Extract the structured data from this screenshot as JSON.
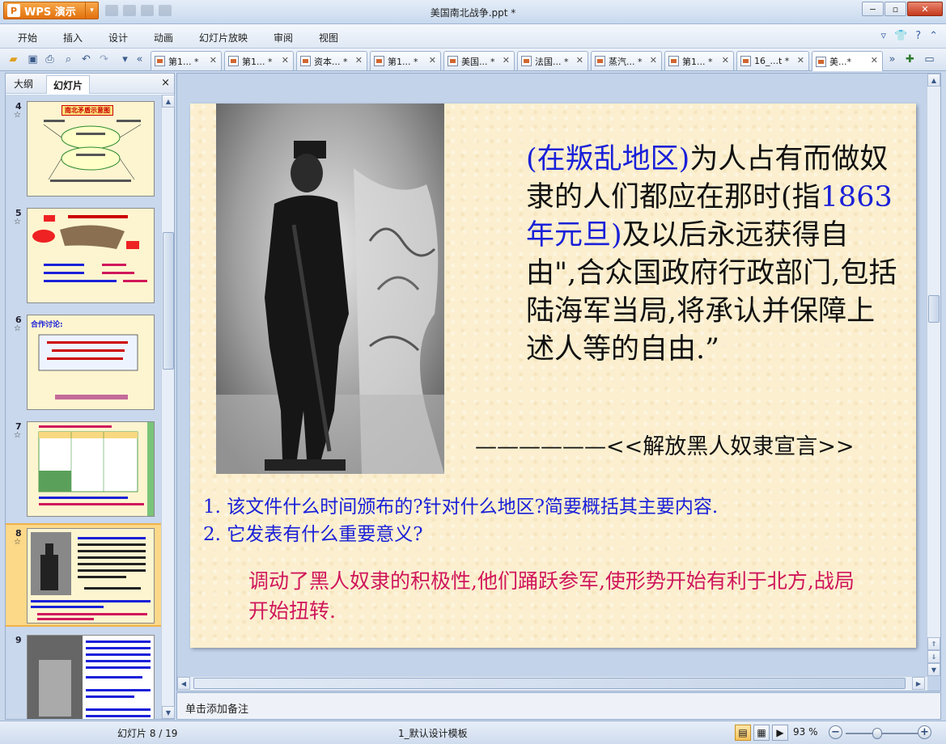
{
  "window": {
    "app_button": "WPS 演示",
    "doc_title": "美国南北战争.ppt *",
    "minimize": "−",
    "restore": "▫",
    "close": "✕"
  },
  "menu": {
    "items": [
      "开始",
      "插入",
      "设计",
      "动画",
      "幻灯片放映",
      "审阅",
      "视图"
    ],
    "help": "?"
  },
  "tabs": [
    {
      "label": "第1... *"
    },
    {
      "label": "第1... *"
    },
    {
      "label": "资本... *"
    },
    {
      "label": "第1... *"
    },
    {
      "label": "美国... *"
    },
    {
      "label": "法国... *"
    },
    {
      "label": "蒸汽... *"
    },
    {
      "label": "第1... *"
    },
    {
      "label": "16_...t *"
    },
    {
      "label": "美...*"
    }
  ],
  "left_panel": {
    "tab_outline": "大纲",
    "tab_slides": "幻灯片",
    "close": "×",
    "thumbnails": [
      {
        "num": "4",
        "title": "南北矛盾示意图"
      },
      {
        "num": "5",
        "title": ""
      },
      {
        "num": "6",
        "title": "合作讨论:"
      },
      {
        "num": "7",
        "title": ""
      },
      {
        "num": "8",
        "title": ""
      },
      {
        "num": "9",
        "title": ""
      }
    ]
  },
  "slide": {
    "quote_part1": "(在叛乱地区)",
    "quote_part2": "为人占有而做奴隶的人们都应在那时(指",
    "quote_part3": "1863年元旦)",
    "quote_part4": "及以后永远获得自由\",合众国政府行政部门,包括陆海军当局,将承认并保障上述人等的自由.”",
    "source": "——————<<解放黑人奴隶宣言>>",
    "question1": "1. 该文件什么时间颁布的?针对什么地区?简要概括其主要内容.",
    "question2": "2. 它发表有什么重要意义?",
    "answer": "调动了黑人奴隶的积极性,他们踊跃参军,使形势开始有利于北方,战局开始扭转."
  },
  "notes": {
    "placeholder": "单击添加备注"
  },
  "status": {
    "slide_counter": "幻灯片 8 / 19",
    "template": "1_默认设计模板",
    "zoom": "93 %",
    "zoom_value": 93
  },
  "colors": {
    "accent_orange": "#e2700c",
    "slide_bg": "#fbefcf",
    "quote_blue": "#1a20d8",
    "answer_pink": "#d0175b",
    "selected_thumb": "#fcd889"
  }
}
